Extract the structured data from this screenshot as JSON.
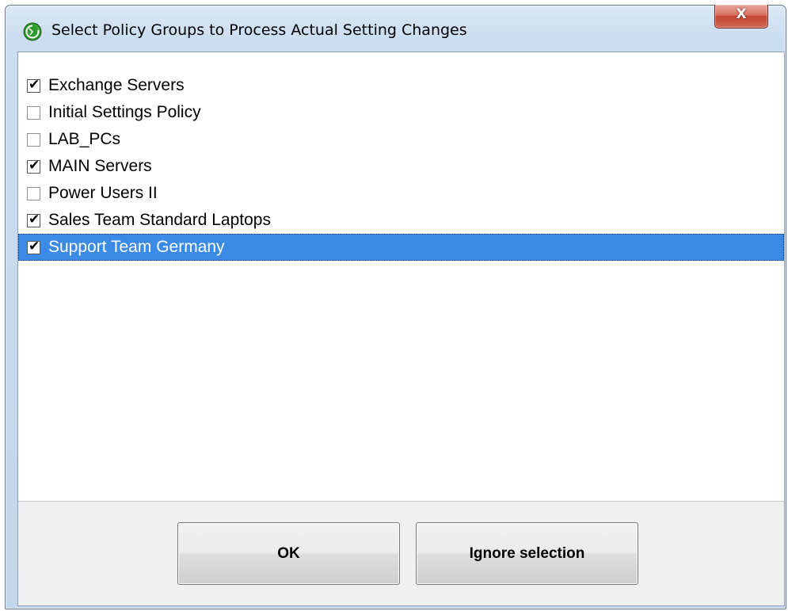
{
  "window": {
    "title": "Select Policy Groups to Process Actual Setting Changes",
    "close_label": "X"
  },
  "colors": {
    "selection": "#3a8ae6",
    "title_icon": "#3aaa35",
    "close_button": "#c4442f"
  },
  "policy_groups": [
    {
      "label": "Exchange Servers",
      "checked": true,
      "selected": false
    },
    {
      "label": "Initial Settings Policy",
      "checked": false,
      "selected": false
    },
    {
      "label": "LAB_PCs",
      "checked": false,
      "selected": false
    },
    {
      "label": "MAIN Servers",
      "checked": true,
      "selected": false
    },
    {
      "label": "Power Users II",
      "checked": false,
      "selected": false
    },
    {
      "label": "Sales Team Standard Laptops",
      "checked": true,
      "selected": false
    },
    {
      "label": "Support Team Germany",
      "checked": true,
      "selected": true
    }
  ],
  "buttons": {
    "ok_label": "OK",
    "ignore_label": "Ignore selection"
  }
}
